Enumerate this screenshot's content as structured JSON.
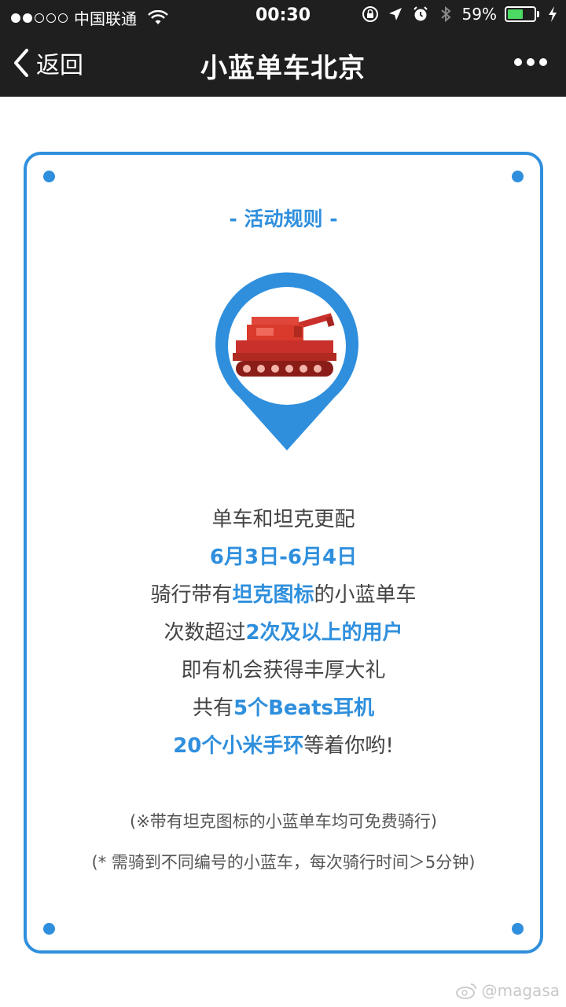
{
  "status_bar": {
    "carrier": "中国联通",
    "time": "00:30",
    "battery_percent": "59%",
    "battery_level": 0.59,
    "signal_strength": 2,
    "signal_total": 5
  },
  "nav": {
    "back_label": "返回",
    "title": "小蓝单车北京"
  },
  "card": {
    "section_title": "- 活动规则 -",
    "lines": [
      {
        "parts": [
          {
            "text": "单车和坦克更配",
            "em": false
          }
        ]
      },
      {
        "parts": [
          {
            "text": "6月3日-6月4日",
            "em": true
          }
        ]
      },
      {
        "parts": [
          {
            "text": "骑行带有",
            "em": false
          },
          {
            "text": "坦克图标",
            "em": true
          },
          {
            "text": "的小蓝单车",
            "em": false
          }
        ]
      },
      {
        "parts": [
          {
            "text": "次数超过",
            "em": false
          },
          {
            "text": "2次及以上的用户",
            "em": true
          }
        ]
      },
      {
        "parts": [
          {
            "text": "即有机会获得丰厚大礼",
            "em": false
          }
        ]
      },
      {
        "parts": [
          {
            "text": "共有",
            "em": false
          },
          {
            "text": "5个Beats耳机",
            "em": true
          }
        ]
      },
      {
        "parts": [
          {
            "text": "20个小米手环",
            "em": true
          },
          {
            "text": "等着你哟!",
            "em": false
          }
        ]
      }
    ],
    "notes": [
      "(※带有坦克图标的小蓝单车均可免费骑行)",
      "(* 需骑到不同编号的小蓝车，每次骑行时间＞5分钟)"
    ]
  },
  "watermark": "@magasa",
  "colors": {
    "accent": "#2f8fdd",
    "bar_bg": "#1f1f1f",
    "tank_red": "#d93a2b",
    "battery_green": "#4cd964"
  },
  "icons": [
    "wifi-icon",
    "lock-rotation-icon",
    "location-arrow-icon",
    "alarm-icon",
    "bluetooth-icon",
    "battery-icon",
    "charging-icon",
    "back-chevron-icon",
    "more-icon",
    "map-pin-icon",
    "tank-icon",
    "weibo-icon"
  ]
}
